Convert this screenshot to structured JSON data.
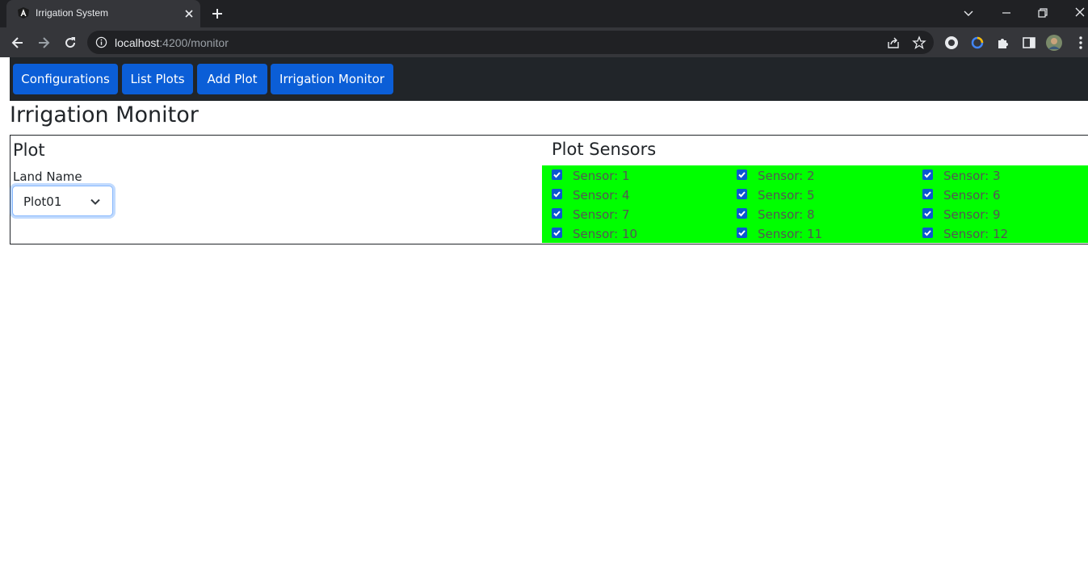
{
  "browser": {
    "tab_title": "Irrigation System",
    "url_host": "localhost",
    "url_rest": ":4200/monitor"
  },
  "icons": {
    "favicon": "angular-logo-icon",
    "tab_close": "close-icon",
    "new_tab": "plus-icon",
    "back": "back-arrow-icon",
    "forward": "forward-arrow-icon",
    "reload": "reload-icon",
    "site_info": "info-icon",
    "share": "share-icon",
    "bookmark": "star-icon",
    "extensions": "puzzle-icon",
    "side_panel": "side-panel-icon",
    "menu": "kebab-menu-icon"
  },
  "nav": {
    "buttons": [
      "Configurations",
      "List Plots",
      "Add Plot",
      "Irrigation Monitor"
    ]
  },
  "page": {
    "title": "Irrigation Monitor",
    "plot_heading": "Plot",
    "land_label": "Land Name",
    "land_selected": "Plot01",
    "sensors_heading": "Plot Sensors"
  },
  "sensors": [
    {
      "label": "Sensor: 1",
      "checked": true
    },
    {
      "label": "Sensor: 2",
      "checked": true
    },
    {
      "label": "Sensor: 3",
      "checked": true
    },
    {
      "label": "Sensor: 4",
      "checked": true
    },
    {
      "label": "Sensor: 5",
      "checked": true
    },
    {
      "label": "Sensor: 6",
      "checked": true
    },
    {
      "label": "Sensor: 7",
      "checked": true
    },
    {
      "label": "Sensor: 8",
      "checked": true
    },
    {
      "label": "Sensor: 9",
      "checked": true
    },
    {
      "label": "Sensor: 10",
      "checked": true
    },
    {
      "label": "Sensor: 11",
      "checked": true
    },
    {
      "label": "Sensor: 12",
      "checked": true
    }
  ],
  "colors": {
    "nav_bg": "#212529",
    "button_bg": "#0b5ed7",
    "sensor_area_bg": "#00ff00",
    "checkbox": "#0b57d0"
  }
}
